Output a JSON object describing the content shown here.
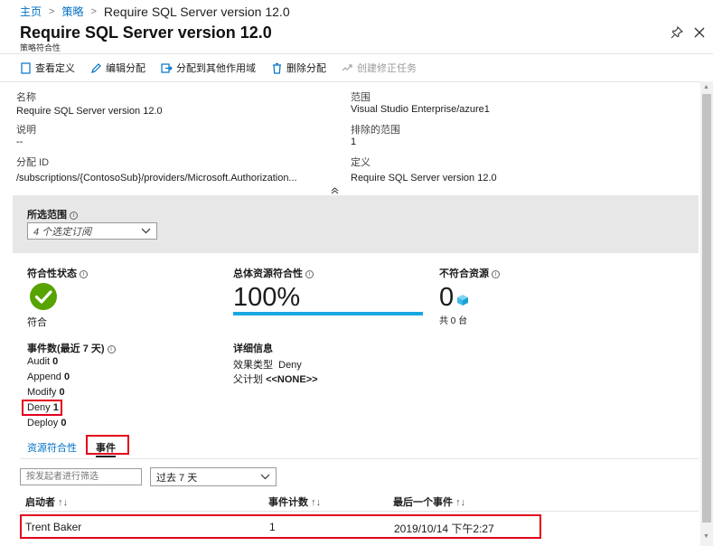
{
  "breadcrumb": {
    "home": "主页",
    "policy": "策略",
    "current": "Require SQL Server version 12.0"
  },
  "header": {
    "title": "Require SQL Server version 12.0",
    "subtitle": "策略符合性"
  },
  "toolbar": {
    "view_definition": "查看定义",
    "edit_assignment": "编辑分配",
    "assign_other_scope": "分配到其他作用域",
    "delete_assignment": "删除分配",
    "create_remediation": "创建修正任务"
  },
  "essentials": {
    "name_label": "名称",
    "name_value": "Require SQL Server version 12.0",
    "description_label": "说明",
    "description_value": "--",
    "assignment_id_label": "分配 ID",
    "assignment_id_value": "/subscriptions/{ContosoSub}/providers/Microsoft.Authorization...",
    "scope_label": "范围",
    "scope_value": "Visual Studio Enterprise/azure1",
    "excluded_scope_label": "排除的范围",
    "excluded_scope_value": "1",
    "definition_label": "定义",
    "definition_value": "Require SQL Server version 12.0"
  },
  "scope_filter": {
    "label": "所选范围",
    "value": "4 个选定订阅"
  },
  "compliance": {
    "state_label": "符合性状态",
    "state_value": "符合",
    "overall_label": "总体资源符合性",
    "overall_value": "100%",
    "overall_fraction": 1.0,
    "noncompliant_label": "不符合资源",
    "noncompliant_value": "0",
    "noncompliant_total": "共 0 台"
  },
  "events": {
    "title": "事件数(最近 7 天)",
    "items": [
      {
        "name": "Audit",
        "count": "0"
      },
      {
        "name": "Append",
        "count": "0"
      },
      {
        "name": "Modify",
        "count": "0"
      },
      {
        "name": "Deny",
        "count": "1"
      },
      {
        "name": "Deploy",
        "count": "0"
      }
    ]
  },
  "details": {
    "title": "详细信息",
    "effect_label": "效果类型",
    "effect_value": "Deny",
    "parent_label": "父计划",
    "parent_value": "<<NONE>>"
  },
  "tabs": {
    "resource_compliance": "资源符合性",
    "events": "事件"
  },
  "filter": {
    "placeholder": "按发起者进行筛选",
    "range": "过去 7 天"
  },
  "table": {
    "col_initiator": "启动者",
    "col_count": "事件计数",
    "col_last": "最后一个事件",
    "rows": [
      {
        "initiator": "Trent Baker",
        "count": "1",
        "last": "2019/10/14 下午2:27"
      }
    ]
  },
  "colors": {
    "accent": "#0072c6",
    "success": "#57a300",
    "progress": "#1aa7e0",
    "highlight": "#e3001b"
  }
}
